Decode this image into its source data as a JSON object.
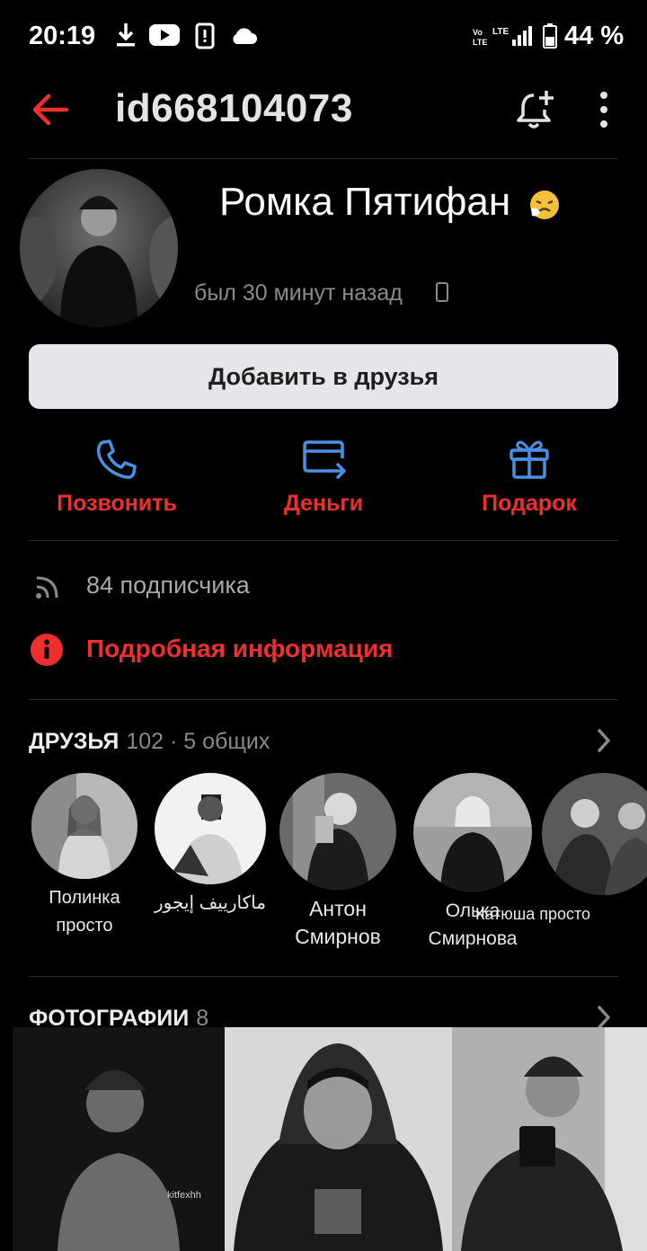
{
  "status_bar": {
    "time": "20:19",
    "battery_pct": "44 %",
    "signal_text_1": "Vo\nLTE",
    "signal_text_2": "LTE",
    "icons": [
      "download-icon",
      "youtube-icon",
      "phone-manager-icon",
      "cloud-icon",
      "volte-icon",
      "signal-icon",
      "battery-icon"
    ]
  },
  "header": {
    "title": "id668104073",
    "icons": [
      "back-arrow-icon",
      "bell-plus-icon",
      "more-vertical-icon"
    ]
  },
  "profile": {
    "name": "Ромка Пятифан",
    "name_emoji": "sneezing-face-emoji",
    "last_seen": "был 30 минут назад",
    "add_friend_label": "Добавить в друзья"
  },
  "actions": [
    {
      "label": "Позвонить",
      "icon": "phone-icon"
    },
    {
      "label": "Деньги",
      "icon": "money-transfer-icon"
    },
    {
      "label": "Подарок",
      "icon": "gift-icon"
    }
  ],
  "subscribers_text": "84 подписчика",
  "details_text": "Подробная информация",
  "friends_section": {
    "title": "ДРУЗЬЯ",
    "count": "102 · 5 общих",
    "items": [
      {
        "name": "Полинка просто"
      },
      {
        "name": "ماكارييف إيجور"
      },
      {
        "name": "Антон Смирнов"
      },
      {
        "name": "Олька Смирнова"
      },
      {
        "name": "Катюша просто"
      }
    ]
  },
  "photos_section": {
    "title": "ФОТОГРАФИИ",
    "count": "8",
    "watermark": "kitfexhh"
  },
  "colors": {
    "accent_red": "#ef2f2f",
    "icon_blue": "#4a90e2",
    "background": "#000000",
    "button_bg": "#e4e6ea"
  }
}
